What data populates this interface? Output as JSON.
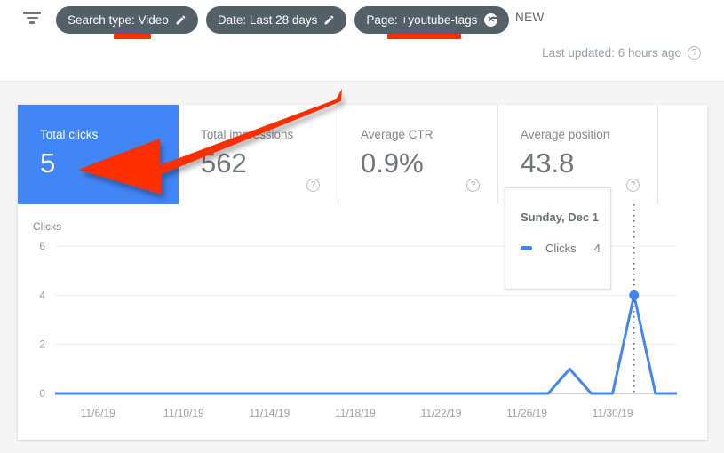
{
  "topbar": {
    "filter_icon": "filter-funnel-icon",
    "chips": [
      {
        "label": "Search type: Video",
        "action_icon": "pencil-icon",
        "underline": true
      },
      {
        "label": "Date: Last 28 days",
        "action_icon": "pencil-icon",
        "underline": false
      },
      {
        "label": "Page: +youtube-tags",
        "action_icon": "close-icon",
        "underline": true
      }
    ],
    "new_button": {
      "label": "NEW",
      "icon": "plus-icon"
    },
    "last_updated": {
      "text": "Last updated: 6 hours ago",
      "help_icon": "question-mark-icon",
      "help_glyph": "?"
    }
  },
  "cards": [
    {
      "title": "Total clicks",
      "value": "5",
      "selected": true,
      "help_glyph": "?"
    },
    {
      "title": "Total impressions",
      "value": "562",
      "selected": false,
      "help_glyph": "?"
    },
    {
      "title": "Average CTR",
      "value": "0.9%",
      "selected": false,
      "help_glyph": "?"
    },
    {
      "title": "Average position",
      "value": "43.8",
      "selected": false,
      "help_glyph": "?"
    }
  ],
  "tooltip": {
    "date": "Sunday, Dec 1",
    "series_name": "Clicks",
    "series_value": "4",
    "series_color": "#4285f4"
  },
  "colors": {
    "accent_blue": "#4285f4",
    "chip_bg": "#546068",
    "annotation_red": "#fd2d00",
    "text_grey": "#70757a"
  },
  "chart_data": {
    "type": "line",
    "title": "",
    "ylabel": "Clicks",
    "xlabel": "",
    "grid": true,
    "legend_position": "none",
    "ylim": [
      0,
      6
    ],
    "yticks": [
      0,
      2,
      4,
      6
    ],
    "ytick_labels": [
      "0",
      "2",
      "4",
      "6"
    ],
    "xtick_labels": [
      "11/6/19",
      "11/10/19",
      "11/14/19",
      "11/18/19",
      "11/22/19",
      "11/26/19",
      "11/30/19"
    ],
    "series": [
      {
        "name": "Clicks",
        "color": "#4285f4",
        "x": [
          "11/4/19",
          "11/5/19",
          "11/6/19",
          "11/7/19",
          "11/8/19",
          "11/9/19",
          "11/10/19",
          "11/11/19",
          "11/12/19",
          "11/13/19",
          "11/14/19",
          "11/15/19",
          "11/16/19",
          "11/17/19",
          "11/18/19",
          "11/19/19",
          "11/20/19",
          "11/21/19",
          "11/22/19",
          "11/23/19",
          "11/24/19",
          "11/25/19",
          "11/26/19",
          "11/27/19",
          "11/28/19",
          "11/29/19",
          "11/30/19",
          "12/1/19",
          "12/2/19",
          "12/3/19"
        ],
        "values": [
          0,
          0,
          0,
          0,
          0,
          0,
          0,
          0,
          0,
          0,
          0,
          0,
          0,
          0,
          0,
          0,
          0,
          0,
          0,
          0,
          0,
          0,
          0,
          0,
          1,
          0,
          0,
          4,
          0,
          0
        ]
      }
    ],
    "highlight": {
      "x": "12/1/19",
      "y": 4,
      "marker": true,
      "vertical_dotted_line": true
    }
  },
  "annotation": {
    "type": "arrow",
    "color": "#fd2d00",
    "points_to": "Total clicks card"
  }
}
